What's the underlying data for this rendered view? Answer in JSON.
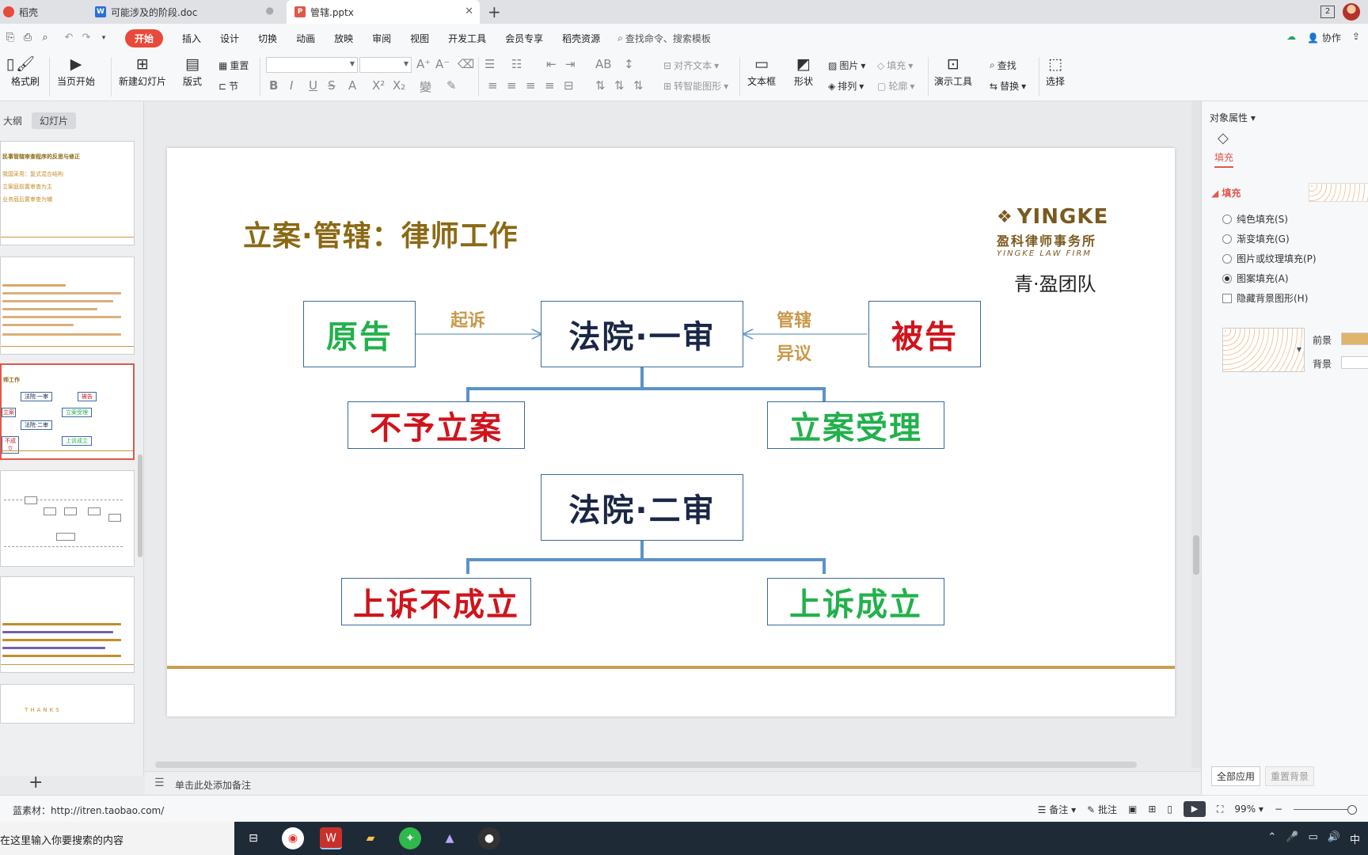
{
  "tabs": [
    {
      "label": "稻壳",
      "icon": "docer-icon"
    },
    {
      "label": "可能涉及的阶段.doc",
      "icon": "word-doc-icon"
    },
    {
      "label": "管辖.pptx",
      "icon": "ppt-icon",
      "active": true
    }
  ],
  "window": {
    "badge": "2"
  },
  "menu": {
    "items": [
      "开始",
      "插入",
      "设计",
      "切换",
      "动画",
      "放映",
      "审阅",
      "视图",
      "开发工具",
      "会员专享",
      "稻壳资源"
    ],
    "search": "查找命令、搜索模板",
    "collab": "协作"
  },
  "ribbon": {
    "format_painter": "格式刷",
    "from_current": "当页开始",
    "new_slide": "新建幻灯片",
    "layout": "版式",
    "reset": "重置",
    "section": "节",
    "align_text": "对齐文本",
    "smartart": "转智能图形",
    "textbox": "文本框",
    "shape": "形状",
    "picture": "图片",
    "arrange": "排列",
    "fill": "填充",
    "outline": "轮廓",
    "present_tools": "演示工具",
    "find": "查找",
    "replace": "替换",
    "select": "选择"
  },
  "left_panel": {
    "tab_outline": "大纲",
    "tab_slides": "幻灯片",
    "thumb1": {
      "title": "民事管辖审查程序的反思与修正",
      "l1": "我国采用：复式混合结构",
      "l2": "立案庭前置审查为主",
      "l3": "业务庭后置审查为辅"
    },
    "thumb3": {
      "title": "师工作",
      "b1": "法院·一审",
      "b2": "被告",
      "b3": "立案",
      "b4": "立案受理",
      "b5": "法院·二审",
      "b6": "不成立",
      "b7": "上诉成立"
    },
    "thumb6": "THANKS"
  },
  "slide": {
    "title": "立案·管辖：律师工作",
    "logo_main": "YINGKE",
    "logo_cn": "盈科律师事务所",
    "logo_en": "YINGKE LAW FIRM",
    "team": "青·盈团队",
    "plaintiff": "原告",
    "court1": "法院·一审",
    "defendant": "被告",
    "label_sue": "起诉",
    "label_juris": "管辖",
    "label_objection": "异议",
    "not_filed": "不予立案",
    "filed": "立案受理",
    "court2": "法院·二审",
    "appeal_fail": "上诉不成立",
    "appeal_ok": "上诉成立"
  },
  "notes": {
    "placeholder": "单击此处添加备注"
  },
  "right_panel": {
    "title": "对象属性",
    "fill_tab": "填充",
    "section": "填充",
    "options": [
      "纯色填充(S)",
      "渐变填充(G)",
      "图片或纹理填充(P)",
      "图案填充(A)"
    ],
    "selected": "图案填充(A)",
    "hide_bg": "隐藏背景图形(H)",
    "foreground": "前景",
    "background": "背景",
    "apply_all": "全部应用",
    "reset_bg": "重置背景",
    "fg_color": "#e0b56a"
  },
  "status": {
    "source": "蓝素材：http://itren.taobao.com/",
    "notes": "备注",
    "comments": "批注",
    "zoom": "99%"
  },
  "taskbar": {
    "search": "在这里输入你要搜索的内容",
    "ime": "中"
  }
}
